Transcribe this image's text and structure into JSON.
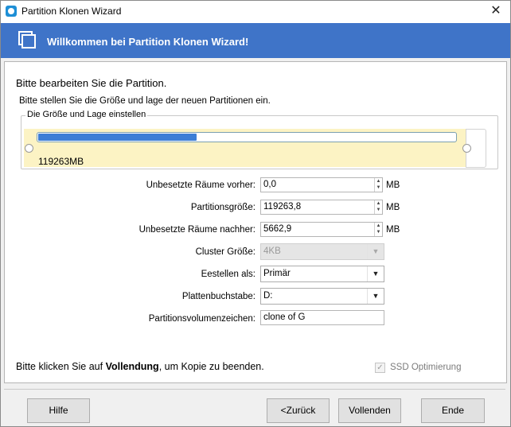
{
  "window": {
    "title": "Partition Klonen Wizard",
    "close_glyph": "✕"
  },
  "banner": {
    "title": "Willkommen bei Partition Klonen Wizard!",
    "icon": "copy-icon"
  },
  "content": {
    "heading": "Bitte bearbeiten Sie die Partition.",
    "subheading": "Bitte stellen Sie die Größe und lage der neuen Partitionen ein.",
    "group_label": "Die Größe und Lage einstellen",
    "partition_bar": {
      "size_label": "119263MB",
      "fill_fraction": 0.38
    },
    "fields": {
      "before": {
        "label": "Unbesetzte Räume vorher:",
        "value": "0,0",
        "unit": "MB"
      },
      "size": {
        "label": "Partitionsgröße:",
        "value": "119263,8",
        "unit": "MB"
      },
      "after": {
        "label": "Unbesetzte Räume nachher:",
        "value": "5662,9",
        "unit": "MB"
      },
      "cluster": {
        "label": "Cluster Größe:",
        "value": "4KB"
      },
      "create_as": {
        "label": "Eestellen als:",
        "value": "Primär"
      },
      "drive_letter": {
        "label": "Plattenbuchstabe:",
        "value": "D:"
      },
      "volume_label": {
        "label": "Partitionsvolumenzeichen:",
        "value": "clone of G"
      }
    },
    "footer_prefix": "Bitte klicken Sie auf ",
    "footer_bold": "Vollendung",
    "footer_suffix": ", um Kopie zu beenden.",
    "ssd": {
      "label": "SSD Optimierung",
      "checked": true
    }
  },
  "buttons": {
    "help": "Hilfe",
    "back": "<Zurück",
    "finish": "Vollenden",
    "end": "Ende"
  },
  "glyphs": {
    "spin_up": "▲",
    "spin_down": "▼",
    "combo_arrow": "▼",
    "check": "✓"
  }
}
